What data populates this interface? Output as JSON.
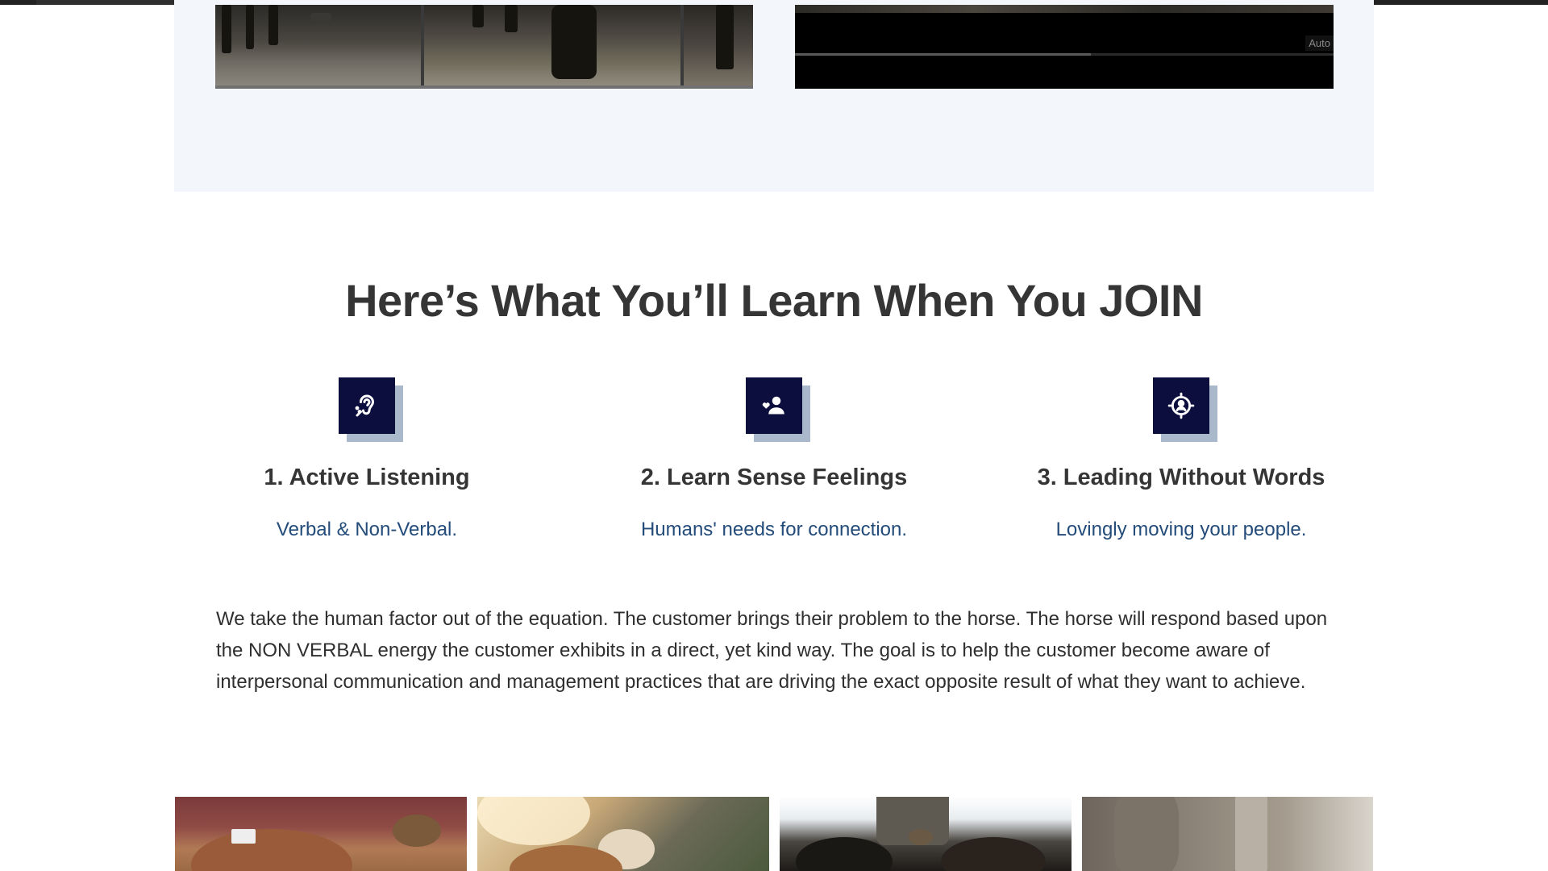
{
  "video": {
    "autoplay_label": "Auto"
  },
  "video_progress_fraction": 0.55,
  "learn_section": {
    "title": "Here’s What You’ll Learn When You JOIN",
    "features": [
      {
        "icon": "hearing-icon",
        "title": "1. Active Listening",
        "subtitle": "Verbal & Non-Verbal."
      },
      {
        "icon": "person-heart-icon",
        "title": "2. Learn Sense Feelings",
        "subtitle": "Humans' needs for connection."
      },
      {
        "icon": "target-person-icon",
        "title": "3. Leading Without Words",
        "subtitle": "Lovingly moving your people."
      }
    ],
    "description": "We take the human factor out of the equation. The customer brings their problem to the horse. The horse will respond based upon the NON VERBAL energy the customer exhibits in a direct, yet kind way. The goal is to help the customer become aware of interpersonal communication and management practices that are driving the exact opposite result of what they want to achieve."
  },
  "colors": {
    "icon_tile": "#0c0f3e",
    "icon_shadow": "#aab8cc",
    "subtitle_text": "#234c7a",
    "band_background": "#f3f6fb"
  }
}
